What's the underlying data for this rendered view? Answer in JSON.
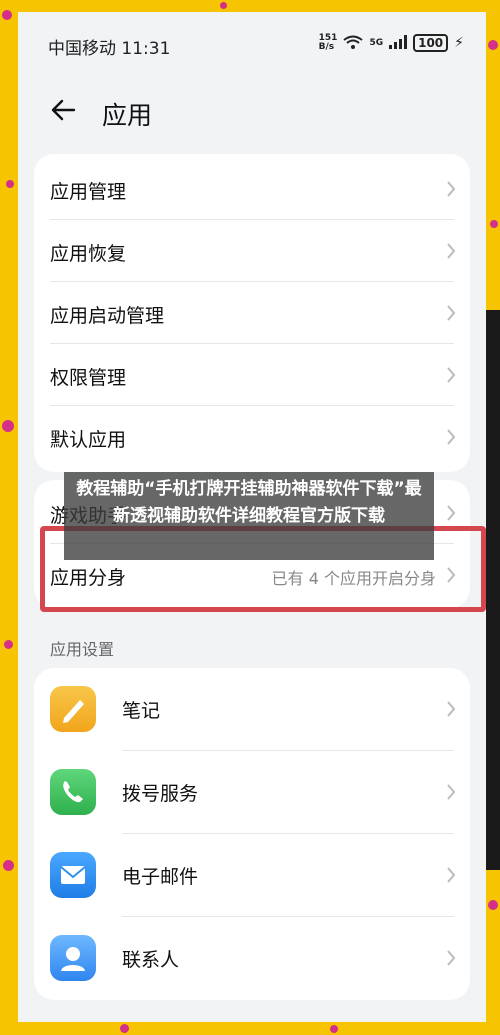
{
  "status_bar": {
    "carrier_time": "中国移动 11:31",
    "net_speed": "151\nB/s",
    "signal": "5G",
    "battery": "100"
  },
  "header": {
    "title": "应用"
  },
  "menu_group_1": [
    {
      "label": "应用管理"
    },
    {
      "label": "应用恢复"
    },
    {
      "label": "应用启动管理"
    },
    {
      "label": "权限管理"
    },
    {
      "label": "默认应用"
    }
  ],
  "menu_group_2": [
    {
      "label": "游戏助手"
    },
    {
      "label": "应用分身",
      "value": "已有 4 个应用开启分身"
    }
  ],
  "section_title": "应用设置",
  "app_settings": [
    {
      "label": "笔记",
      "icon": "notes-icon",
      "color": "#f5b52e"
    },
    {
      "label": "拨号服务",
      "icon": "phone-icon",
      "color": "#3cc35f"
    },
    {
      "label": "电子邮件",
      "icon": "mail-icon",
      "color": "#2f8ff0"
    },
    {
      "label": "联系人",
      "icon": "contacts-icon",
      "color": "#3d9cf5"
    }
  ],
  "overlay_caption": "教程辅助“手机打牌开挂辅助神器软件下载”最新透视辅助软件详细教程官方版下载",
  "colors": {
    "background": "#f6c400",
    "dots": "#d62f8a",
    "highlight_box": "#d4474f"
  }
}
